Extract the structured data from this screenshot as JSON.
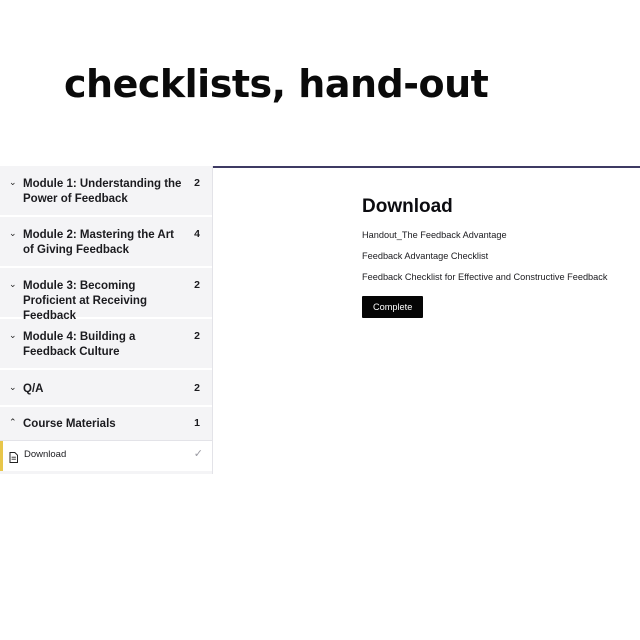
{
  "headline": "checklists, hand-out",
  "sidebar": {
    "modules": [
      {
        "title": "Module 1: Understanding the Power of Feedback",
        "count": "2",
        "expanded": false
      },
      {
        "title": "Module 2: Mastering the Art of Giving Feedback",
        "count": "4",
        "expanded": false
      },
      {
        "title": "Module 3: Becoming Proficient at Receiving Feedback",
        "count": "2",
        "expanded": false
      },
      {
        "title": "Module 4: Building a Feedback Culture",
        "count": "2",
        "expanded": false
      },
      {
        "title": "Q/A",
        "count": "2",
        "expanded": false
      },
      {
        "title": "Course Materials",
        "count": "1",
        "expanded": true
      }
    ],
    "active_lesson": {
      "label": "Download",
      "icon": "document-icon",
      "status_icon": "checkmark-icon"
    }
  },
  "content": {
    "title": "Download",
    "resources": [
      "Handout_The Feedback Advantage",
      "Feedback Advantage Checklist",
      "Feedback Checklist for Effective and Constructive Feedback"
    ],
    "complete_label": "Complete"
  },
  "colors": {
    "accent_rule": "#3d3a63",
    "active_marker": "#e8c64a",
    "sidebar_bg": "#f4f4f6",
    "button_bg": "#050505"
  }
}
